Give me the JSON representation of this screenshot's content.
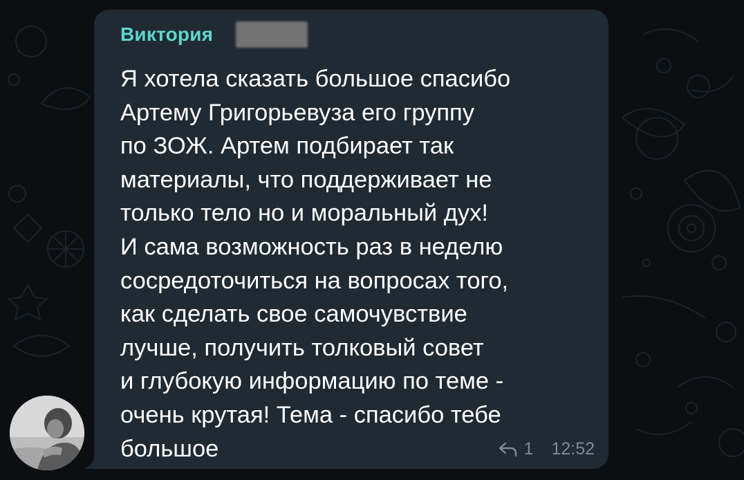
{
  "colors": {
    "background": "#0b0f12",
    "bubble": "#1f2a33",
    "sender_name": "#5ed6cc",
    "message_text": "#ffffff",
    "meta_text": "#7c8b96"
  },
  "message": {
    "sender_name": "Виктория",
    "sender_name_redacted": true,
    "text_lines": [
      "Я хотела сказать большое спасибо",
      "Артему Григорьевуза его группу",
      "по ЗОЖ. Артем подбирает так",
      "материалы, что поддерживает не",
      "только тело но и моральный дух!",
      "И сама возможность раз в неделю",
      "сосредоточиться на вопросах того,",
      "как сделать свое самочувствие",
      "лучше, получить толковый совет",
      "и глубокую информацию по теме -",
      "очень крутая! Тема - спасибо тебе",
      "большое"
    ],
    "reply_count": "1",
    "reply_icon": "reply-arrow-icon",
    "time": "12:52"
  },
  "avatar": {
    "icon": "user-photo-avatar"
  }
}
